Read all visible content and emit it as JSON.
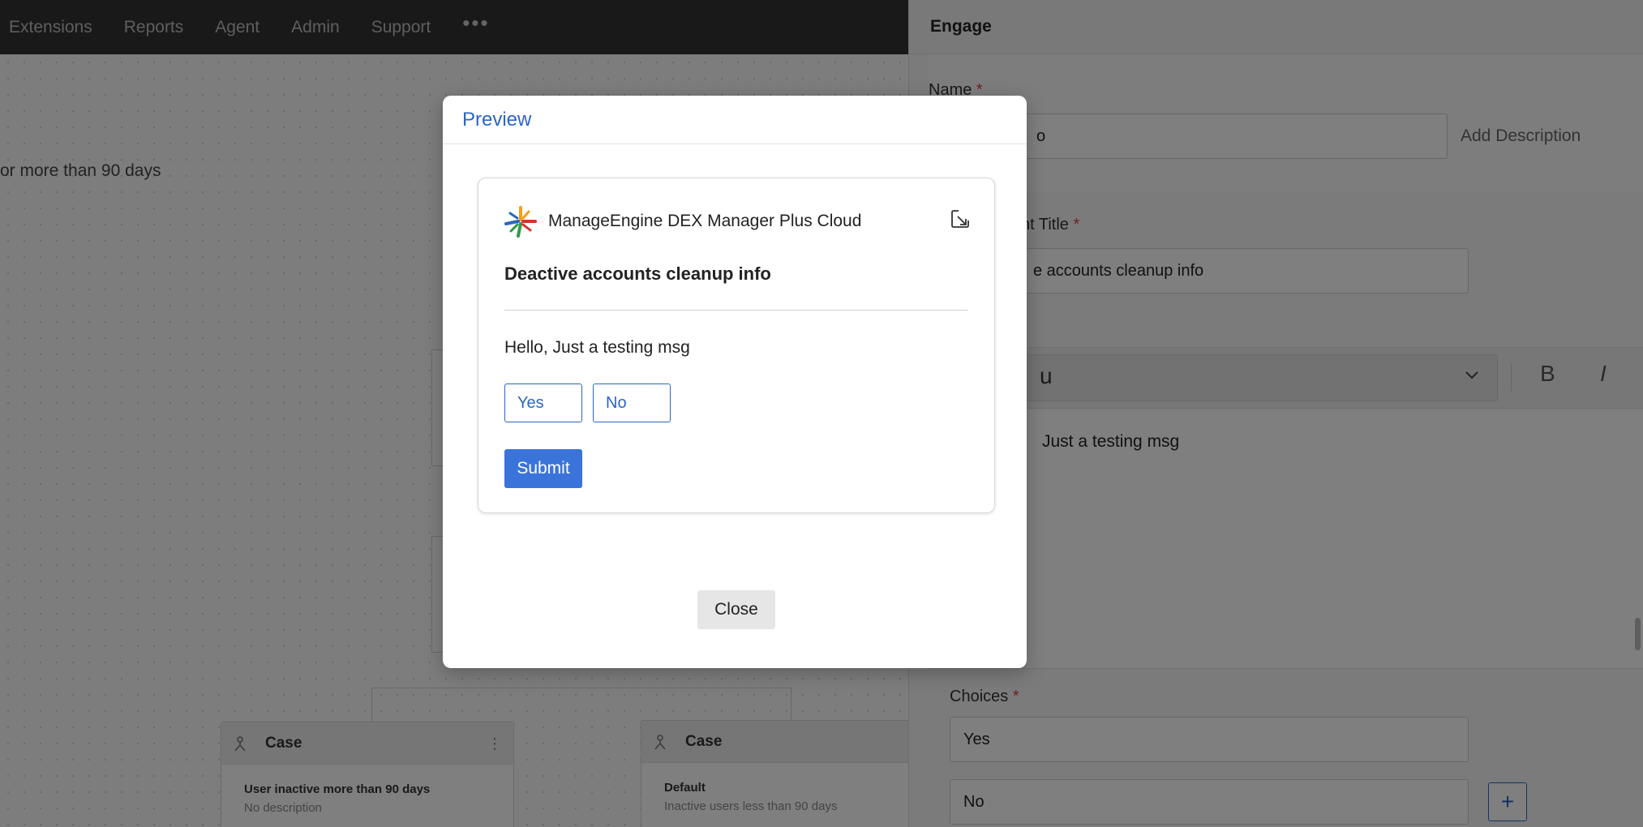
{
  "topnav": {
    "items": [
      "Extensions",
      "Reports",
      "Agent",
      "Admin",
      "Support"
    ],
    "more_icon": "more-horizontal-icon"
  },
  "canvas": {
    "description_fragment": "or more than 90 days",
    "cases": [
      {
        "title": "Case",
        "name": "User inactive more than 90 days",
        "description": "No description",
        "icon": "branch-icon",
        "menu_icon": "kebab-icon"
      },
      {
        "title": "Case",
        "name": "Default",
        "description": "Inactive users less than 90 days",
        "icon": "branch-icon"
      }
    ]
  },
  "panel": {
    "title": "Engage",
    "name_label": "Name",
    "required_mark": "*",
    "name_value": "o",
    "add_description": "Add Description",
    "title_label_fragment": "nt Title",
    "title_value_fragment": "e accounts cleanup info",
    "font_fragment": "u",
    "bold_label": "B",
    "italic_label": "I",
    "editor_text_fragment": "Just a testing msg",
    "choices_label": "Choices",
    "choices": [
      "Yes",
      "No"
    ],
    "add_choice_label": "+"
  },
  "modal": {
    "title": "Preview",
    "notification": {
      "app_name": "ManageEngine DEX Manager Plus Cloud",
      "logo_icon": "manageengine-logo-icon",
      "expand_icon": "expand-arrow-icon",
      "subject": "Deactive accounts cleanup info",
      "message": "Hello, Just a testing msg",
      "choices": [
        "Yes",
        "No"
      ],
      "submit_label": "Submit"
    },
    "close_label": "Close"
  },
  "colors": {
    "accent": "#2b65c4",
    "submit": "#3a74db",
    "topbar": "#323232"
  }
}
